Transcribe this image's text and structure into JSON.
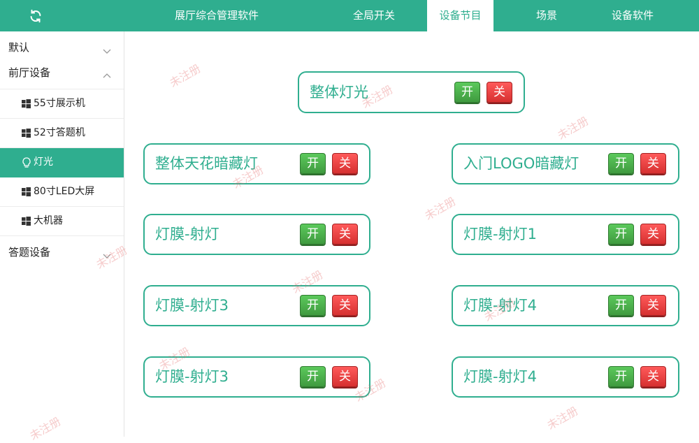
{
  "header": {
    "refresh_icon": "refresh-icon",
    "app_title": "展厅综合管理软件",
    "tabs": [
      {
        "label": "全局开关",
        "active": false
      },
      {
        "label": "设备节目",
        "active": true
      },
      {
        "label": "场景",
        "active": false
      },
      {
        "label": "设备软件",
        "active": false
      }
    ]
  },
  "sidebar": {
    "groups": [
      {
        "label": "默认",
        "expanded": false
      },
      {
        "label": "前厅设备",
        "expanded": true
      },
      {
        "label": "答题设备",
        "expanded": false
      }
    ],
    "items": [
      {
        "label": "55寸展示机",
        "icon": "windows-icon"
      },
      {
        "label": "52寸答题机",
        "icon": "windows-icon"
      },
      {
        "label": "灯光",
        "icon": "bulb-icon",
        "active": true
      },
      {
        "label": "80寸LED大屏",
        "icon": "windows-icon"
      },
      {
        "label": "大机器",
        "icon": "windows-icon"
      }
    ]
  },
  "main": {
    "button_on": "开",
    "button_off": "关",
    "controls": [
      {
        "label": "整体灯光"
      },
      {
        "label": "整体天花暗藏灯"
      },
      {
        "label": "入门LOGO暗藏灯"
      },
      {
        "label": "灯膜-射灯"
      },
      {
        "label": "灯膜-射灯1"
      },
      {
        "label": "灯膜-射灯3"
      },
      {
        "label": "灯膜-射灯4"
      },
      {
        "label": "灯膜-射灯3"
      },
      {
        "label": "灯膜-射灯4"
      }
    ]
  },
  "watermark": "未注册",
  "colors": {
    "accent": "#2fae8f",
    "on": "#4cae4c",
    "off": "#e23a3a"
  }
}
